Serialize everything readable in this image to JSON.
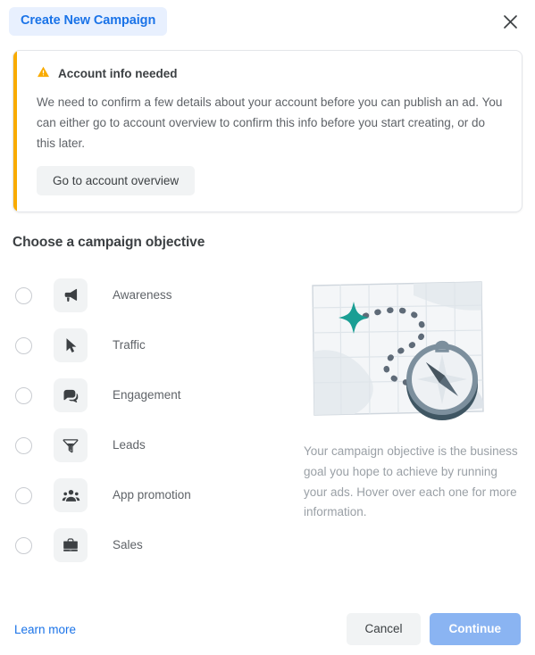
{
  "header": {
    "title": "Create New Campaign",
    "close_icon": "close-icon"
  },
  "alert": {
    "icon": "warning-triangle-icon",
    "title": "Account info needed",
    "body": "We need to confirm a few details about your account before you can publish an ad. You can either go to account overview to confirm this info before you start creating, or do this later.",
    "action_label": "Go to account overview",
    "accent_color": "#f9ab00"
  },
  "section": {
    "title": "Choose a campaign objective"
  },
  "objectives": [
    {
      "label": "Awareness",
      "icon": "megaphone-icon",
      "selected": false
    },
    {
      "label": "Traffic",
      "icon": "cursor-arrow-icon",
      "selected": false
    },
    {
      "label": "Engagement",
      "icon": "chat-bubbles-icon",
      "selected": false
    },
    {
      "label": "Leads",
      "icon": "funnel-icon",
      "selected": false
    },
    {
      "label": "App promotion",
      "icon": "people-group-icon",
      "selected": false
    },
    {
      "label": "Sales",
      "icon": "briefcase-icon",
      "selected": false
    }
  ],
  "info_panel": {
    "illustration": "map-with-compass-illustration",
    "caption": "Your campaign objective is the business goal you hope to achieve by running your ads. Hover over each one for more information."
  },
  "footer": {
    "learn_more_label": "Learn more",
    "cancel_label": "Cancel",
    "continue_label": "Continue",
    "continue_enabled": false,
    "accent_color": "#1a73e8",
    "continue_color": "#8ab4f2"
  }
}
